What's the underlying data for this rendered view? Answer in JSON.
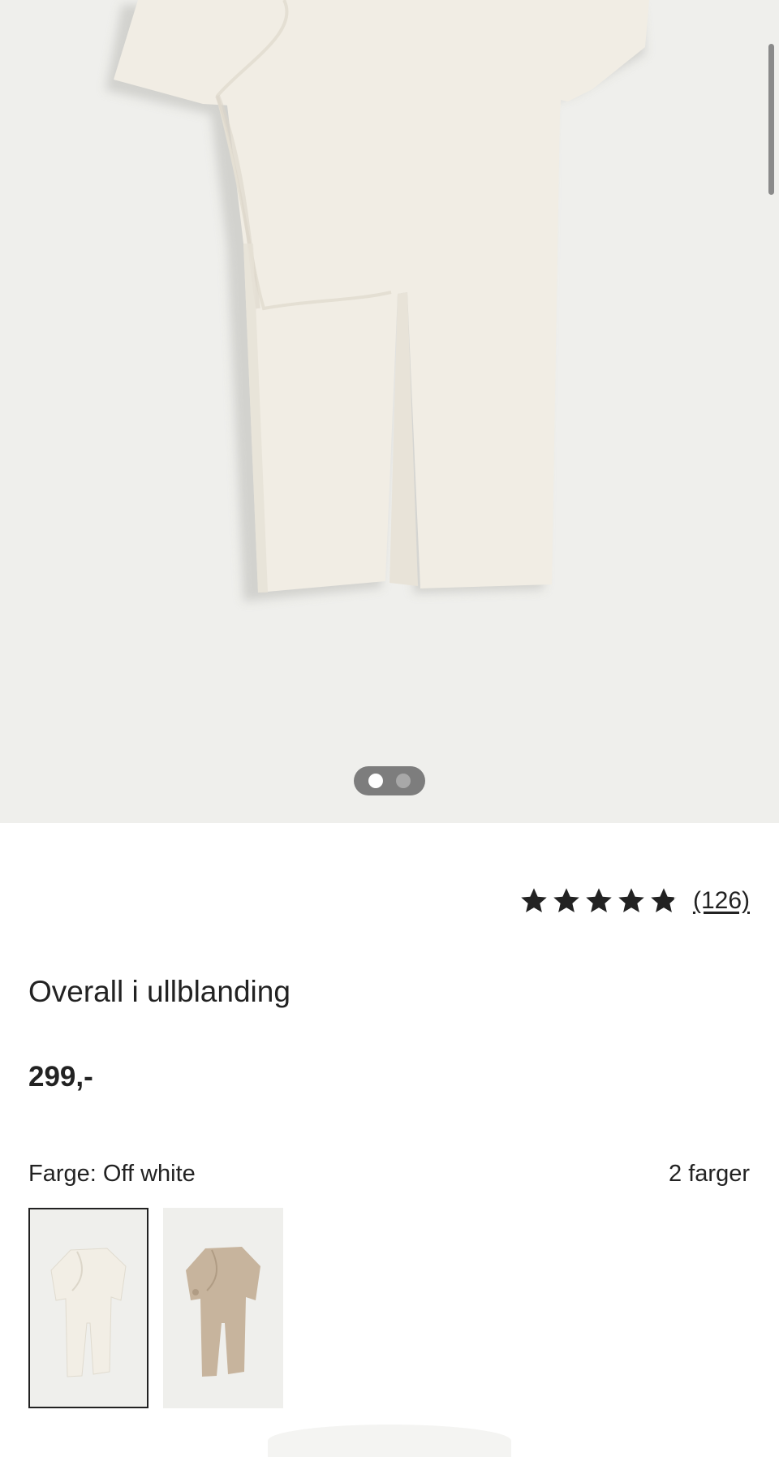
{
  "product": {
    "title": "Overall i ullblanding",
    "price": "299,-",
    "rating": {
      "stars": 4.8,
      "max_stars": 5,
      "review_count": "(126)"
    },
    "color": {
      "label": "Farge: Off white",
      "count_label": "2 farger",
      "options": [
        {
          "name": "Off white",
          "hex": "#f2eee5",
          "selected": true
        },
        {
          "name": "Beige",
          "hex": "#c7b49d",
          "selected": false
        }
      ]
    }
  },
  "gallery": {
    "current_index": 1,
    "total_images": 2
  },
  "colors": {
    "text": "#222222",
    "image_background": "#efefec",
    "garment": "#f1ede4"
  }
}
